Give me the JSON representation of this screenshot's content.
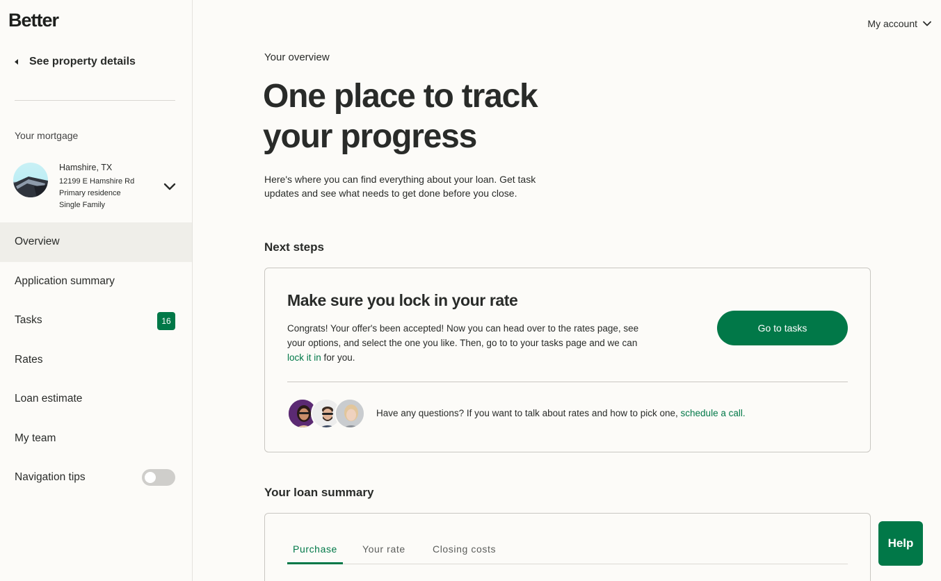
{
  "brand": {
    "logo": "Better",
    "accent": "#017848"
  },
  "sidebar": {
    "back_link": "See property details",
    "section_label": "Your mortgage",
    "property": {
      "city": "Hamshire, TX",
      "address": "12199 E Hamshire Rd",
      "occupancy": "Primary residence",
      "type": "Single Family"
    },
    "nav": [
      {
        "label": "Overview",
        "active": true
      },
      {
        "label": "Application summary"
      },
      {
        "label": "Tasks",
        "badge": "16"
      },
      {
        "label": "Rates"
      },
      {
        "label": "Loan estimate"
      },
      {
        "label": "My team"
      },
      {
        "label": "Navigation tips",
        "toggle": false
      }
    ]
  },
  "header": {
    "account_label": "My account"
  },
  "main": {
    "eyebrow": "Your overview",
    "title": "One place to track your progress",
    "intro": "Here's where you can find everything about your loan. Get task updates and see what needs to get done before you close.",
    "next_steps": {
      "heading": "Next steps",
      "card_title": "Make sure you lock in your rate",
      "body_before": "Congrats! Your offer's been accepted! Now you can head over to the rates page, see your options, and select the one you like. Then, go to to your tasks page and we can ",
      "body_link": "lock it in",
      "body_after": " for you.",
      "button": "Go to tasks",
      "questions_text": "Have any questions? If you want to talk about rates and how to pick one, ",
      "questions_link": "schedule a call."
    },
    "loan_summary": {
      "heading": "Your loan summary",
      "tabs": [
        "Purchase",
        "Your rate",
        "Closing costs"
      ],
      "active_tab": "Purchase"
    }
  },
  "help_button": "Help"
}
